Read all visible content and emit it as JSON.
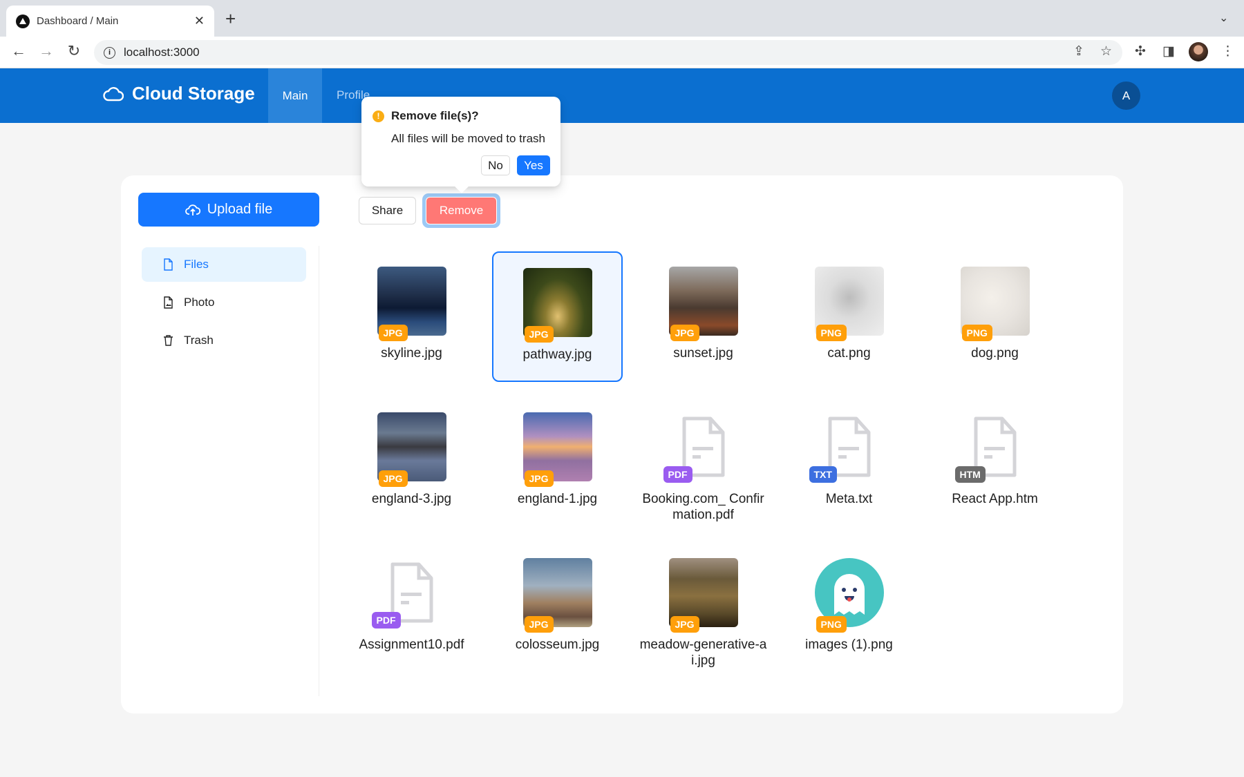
{
  "browser": {
    "tab_title": "Dashboard / Main",
    "url": "localhost:3000"
  },
  "app": {
    "title": "Cloud Storage",
    "nav": [
      "Main",
      "Profile"
    ],
    "avatar_initial": "A"
  },
  "upload_label": "Upload file",
  "sidebar": [
    {
      "label": "Files",
      "icon": "file-icon",
      "active": true
    },
    {
      "label": "Photo",
      "icon": "file-image-icon"
    },
    {
      "label": "Trash",
      "icon": "trash-icon"
    }
  ],
  "actions": {
    "share": "Share",
    "remove": "Remove"
  },
  "popconfirm": {
    "title": "Remove file(s)?",
    "description": "All files will be moved to trash",
    "no": "No",
    "yes": "Yes"
  },
  "colors": {
    "header": "#0b6fd0",
    "primary": "#1677ff",
    "danger": "#ff7875",
    "jpg": "#ff9f0a",
    "png": "#ff9f0a",
    "pdf": "#9a5cf0",
    "txt": "#3d6fe0",
    "htm": "#6b6b6b"
  },
  "files": [
    {
      "name": "skyline.jpg",
      "type": "JPG"
    },
    {
      "name": "pathway.jpg",
      "type": "JPG",
      "selected": true
    },
    {
      "name": "sunset.jpg",
      "type": "JPG"
    },
    {
      "name": "cat.png",
      "type": "PNG"
    },
    {
      "name": "dog.png",
      "type": "PNG"
    },
    {
      "name": "england-3.jpg",
      "type": "JPG"
    },
    {
      "name": "england-1.jpg",
      "type": "JPG"
    },
    {
      "name": "Booking.com_ Confirmation.pdf",
      "type": "PDF"
    },
    {
      "name": "Meta.txt",
      "type": "TXT"
    },
    {
      "name": "React App.htm",
      "type": "HTM"
    },
    {
      "name": "Assignment10.pdf",
      "type": "PDF"
    },
    {
      "name": "colosseum.jpg",
      "type": "JPG"
    },
    {
      "name": "meadow-generative-ai.jpg",
      "type": "JPG"
    },
    {
      "name": "images (1).png",
      "type": "PNG"
    }
  ]
}
